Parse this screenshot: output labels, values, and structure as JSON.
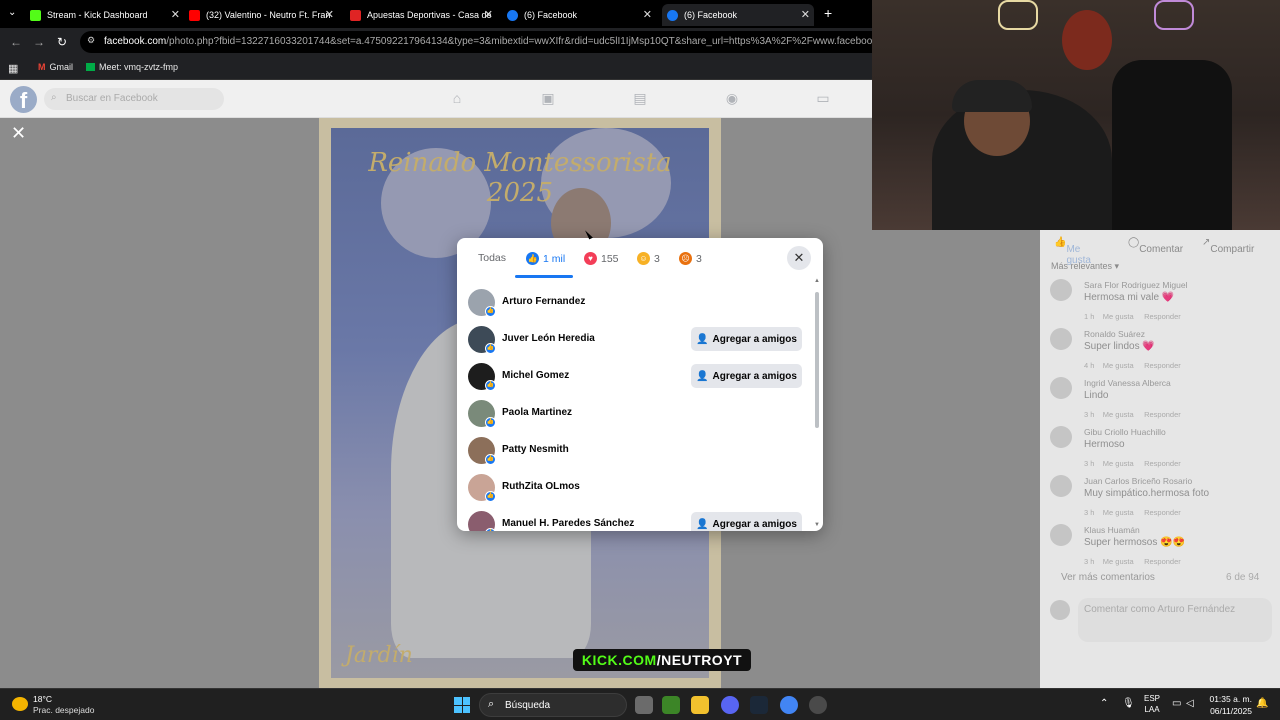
{
  "browser": {
    "tabs": [
      {
        "label": "Stream - Kick Dashboard",
        "color": "#53fc18"
      },
      {
        "label": "(32) Valentino - Neutro Ft. Fran",
        "color": "#ff0000"
      },
      {
        "label": "Apuestas Deportivas - Casa de",
        "color": "#e02424"
      },
      {
        "label": "(6) Facebook",
        "color": "#1877f2"
      },
      {
        "label": "(6) Facebook",
        "color": "#1877f2"
      }
    ],
    "url_domain": "facebook.com",
    "url_path": "/photo.php?fbid=1322716033201744&set=a.475092217964134&type=3&mibextid=wwXIfr&rdid=udc5lI1IjMsp10QT&share_url=https%3A%2F%2Fwww.facebook.com%2Fs",
    "bookmarks": [
      {
        "label": "Gmail"
      },
      {
        "label": "Meet: vmq-zvtz-fmp"
      }
    ]
  },
  "facebook": {
    "search_placeholder": "Buscar en Facebook",
    "photo": {
      "title": "Reinado Montessorista 2025",
      "caption": "Jardín"
    }
  },
  "reactions_modal": {
    "tabs": [
      {
        "label": "Todas"
      },
      {
        "label": "1 mil",
        "icon": "like-icon"
      },
      {
        "label": "155",
        "icon": "love-icon"
      },
      {
        "label": "3",
        "icon": "care-icon"
      },
      {
        "label": "3",
        "icon": "angry-icon"
      }
    ],
    "add_friend_label": "Agregar a amigos",
    "people": [
      {
        "name": "Arturo Fernandez",
        "add": false,
        "color": "#9ba3ad"
      },
      {
        "name": "Juver León Heredia",
        "add": true,
        "color": "#3d4a57"
      },
      {
        "name": "Michel Gomez",
        "add": true,
        "color": "#1d1d1d"
      },
      {
        "name": "Paola Martinez",
        "add": false,
        "color": "#7a8a7a"
      },
      {
        "name": "Patty Nesmith",
        "add": false,
        "color": "#8c6f5a"
      },
      {
        "name": "RuthZita OLmos",
        "add": false,
        "color": "#c9a496"
      },
      {
        "name": "Manuel H. Paredes Sánchez",
        "add": true,
        "color": "#8a5d6e"
      }
    ]
  },
  "comments_panel": {
    "actions": [
      "Me gusta",
      "Comentar",
      "Compartir"
    ],
    "filter": "Más relevantes",
    "comments": [
      {
        "name": "Sara Flor Rodriguez Miguel",
        "text": "Hermosa mi vale 💗",
        "time": "1 h",
        "like": "Me gusta",
        "reply": "Responder"
      },
      {
        "name": "Ronaldo Suárez",
        "text": "Super lindos 💗",
        "time": "4 h",
        "like": "Me gusta",
        "reply": "Responder"
      },
      {
        "name": "Ingrid Vanessa Alberca",
        "text": "Lindo",
        "time": "3 h",
        "like": "Me gusta",
        "reply": "Responder"
      },
      {
        "name": "Gibu Criollo Huachillo",
        "text": "Hermoso",
        "time": "3 h",
        "like": "Me gusta",
        "reply": "Responder"
      },
      {
        "name": "Juan Carlos Briceño Rosario",
        "text": "Muy simpático.hermosa foto",
        "time": "3 h",
        "like": "Me gusta",
        "reply": "Responder"
      },
      {
        "name": "Klaus Huamán",
        "text": "Super hermosos 😍😍",
        "time": "3 h",
        "like": "Me gusta",
        "reply": "Responder"
      }
    ],
    "more_comments": "Ver más comentarios",
    "count": "6 de 94",
    "comment_placeholder": "Comentar como Arturo Fernández"
  },
  "overlay": {
    "kick_prefix": "KICK.COM",
    "kick_suffix": "/NEUTROYT"
  },
  "taskbar": {
    "temperature": "18°C",
    "condition": "Prac. despejado",
    "search_label": "Búsqueda",
    "language": "ESP",
    "layout": "LAA",
    "time": "01:35 a. m.",
    "date": "06/11/2025"
  }
}
